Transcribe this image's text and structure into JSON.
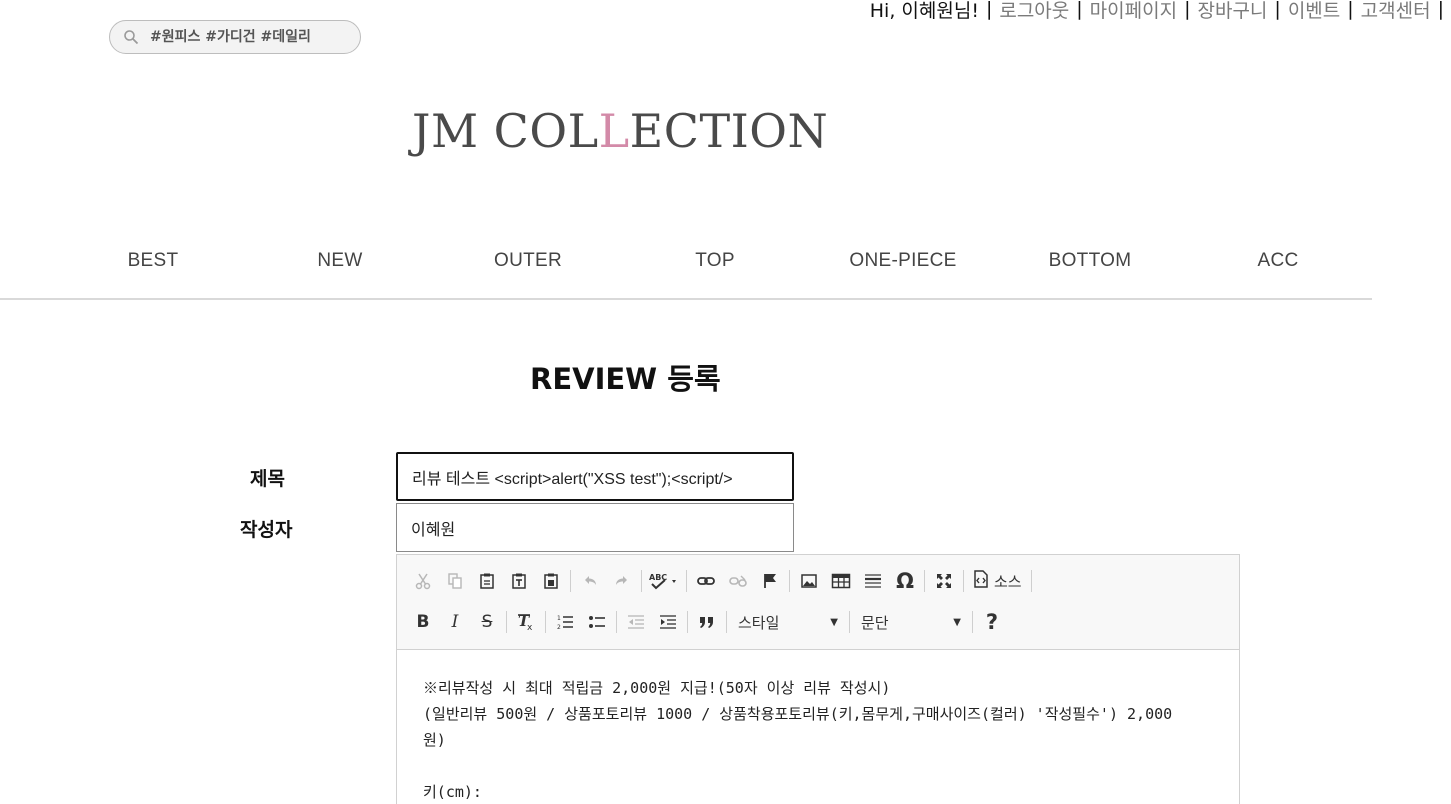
{
  "header": {
    "search": {
      "placeholder": "#원피스 #가디건 #데일리",
      "icon": "search-icon"
    },
    "util_nav": {
      "greeting": "Hi, 이혜원님!",
      "links": [
        "로그아웃",
        "마이페이지",
        "장바구니",
        "이벤트",
        "고객센터"
      ],
      "separator": "|"
    },
    "logo": {
      "pre": "JM COL",
      "accent": "L",
      "post": "ECTION",
      "accent_color": "#d38aa8"
    }
  },
  "category_nav": [
    "BEST",
    "NEW",
    "OUTER",
    "TOP",
    "ONE-PIECE",
    "BOTTOM",
    "ACC"
  ],
  "page": {
    "title": "REVIEW 등록"
  },
  "form": {
    "title_label": "제목",
    "title_value": "리뷰 테스트 <script>alert(\"XSS test\");<script/>",
    "writer_label": "작성자",
    "writer_value": "이혜원"
  },
  "editor": {
    "toolbar_row1": [
      "cut-icon",
      "copy-icon",
      "paste-icon",
      "paste-text-icon",
      "paste-word-icon",
      "undo-icon",
      "redo-icon",
      "spellcheck-icon",
      "link-icon",
      "unlink-icon",
      "anchor-icon",
      "image-icon",
      "table-icon",
      "horizontal-rule-icon",
      "special-char-icon",
      "maximize-icon",
      "source-icon"
    ],
    "source_label": "소스",
    "toolbar_row2": [
      "bold-icon",
      "italic-icon",
      "strike-icon",
      "remove-format-icon",
      "numbered-list-icon",
      "bulleted-list-icon",
      "outdent-icon",
      "indent-icon",
      "blockquote-icon",
      "help-icon"
    ],
    "style_label": "스타일",
    "format_label": "문단",
    "bold_glyph": "B",
    "italic_glyph": "I",
    "strike_glyph": "S",
    "special_glyph": "Ω",
    "help_glyph": "?",
    "content_lines": [
      "※리뷰작성 시 최대 적립금 2,000원 지급!(50자 이상 리뷰 작성시)",
      "(일반리뷰 500원 / 상품포토리뷰 1000 / 상품착용포토리뷰(키,몸무게,구매사이즈(컬러) '작성필수') 2,000",
      "원)",
      "",
      "키(cm):"
    ]
  }
}
